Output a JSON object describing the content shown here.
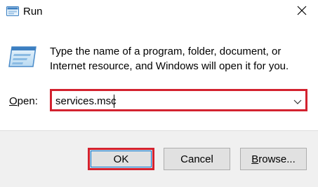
{
  "window": {
    "title": "Run"
  },
  "dialog": {
    "description": "Type the name of a program, folder, document, or Internet resource, and Windows will open it for you.",
    "open_label_mnemonic": "O",
    "open_label_rest": "pen:",
    "open_value": "services.msc"
  },
  "buttons": {
    "ok": "OK",
    "cancel": "Cancel",
    "browse_mnemonic": "B",
    "browse_rest": "rowse..."
  },
  "icons": {
    "app": "run-app-icon",
    "program": "program-window-icon",
    "close": "close-icon",
    "dropdown": "chevron-down-icon"
  },
  "colors": {
    "highlight": "#d3222f",
    "button_focus": "#0078d7",
    "footer_bg": "#f0f0f0",
    "button_bg": "#e1e1e1"
  }
}
